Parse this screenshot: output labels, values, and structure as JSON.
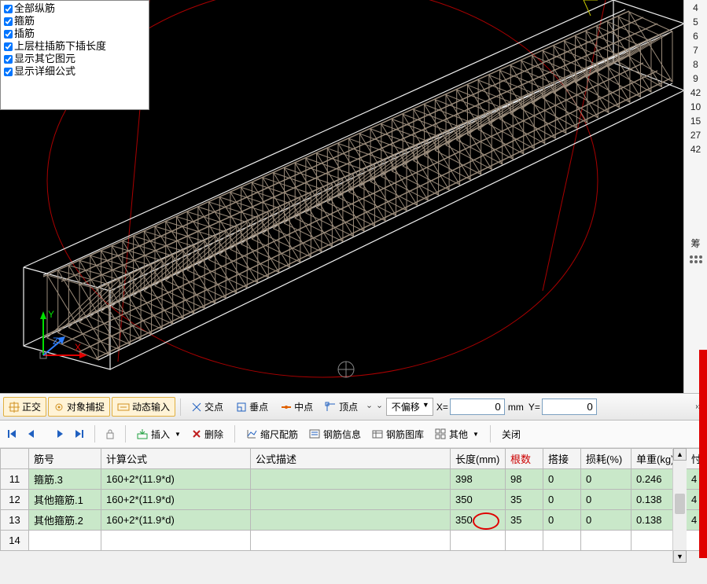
{
  "checkboxes": [
    {
      "label": "全部纵筋",
      "checked": true
    },
    {
      "label": "箍筋",
      "checked": true
    },
    {
      "label": "插筋",
      "checked": true
    },
    {
      "label": "上层柱插筋下插长度",
      "checked": true
    },
    {
      "label": "显示其它图元",
      "checked": true
    },
    {
      "label": "显示详细公式",
      "checked": true
    }
  ],
  "side_numbers": [
    "4",
    "5",
    "6",
    "7",
    "8",
    "9",
    "42",
    "10",
    "15",
    "27",
    "42"
  ],
  "side_char": "筹",
  "statusbar": {
    "ortho": "正交",
    "snap": "对象捕捉",
    "dyn_input": "动态输入",
    "jiaodian": "交点",
    "chuidian": "垂点",
    "zhongdian": "中点",
    "dingdian": "顶点",
    "offset": "不偏移",
    "x_label": "X=",
    "x_value": "0",
    "unit": "mm",
    "y_label": "Y=",
    "y_value": "0"
  },
  "toolbar": {
    "insert": "插入",
    "delete": "删除",
    "scale": "缩尺配筋",
    "info": "钢筋信息",
    "library": "钢筋图库",
    "other": "其他",
    "close": "关闭"
  },
  "table": {
    "headers": {
      "num": "筋号",
      "formula": "计算公式",
      "desc": "公式描述",
      "length": "长度(mm)",
      "count": "根数",
      "overlap": "搭接",
      "loss": "损耗(%)",
      "unit_weight": "单重(kg)",
      "last": "忖"
    },
    "rows": [
      {
        "n": "11",
        "num": "箍筋.3",
        "formula": "160+2*(11.9*d)",
        "desc": "",
        "length": "398",
        "count": "98",
        "overlap": "0",
        "loss": "0",
        "uw": "0.246",
        "last": "4"
      },
      {
        "n": "12",
        "num": "其他箍筋.1",
        "formula": "160+2*(11.9*d)",
        "desc": "",
        "length": "350",
        "count": "35",
        "overlap": "0",
        "loss": "0",
        "uw": "0.138",
        "last": "4"
      },
      {
        "n": "13",
        "num": "其他箍筋.2",
        "formula": "160+2*(11.9*d)",
        "desc": "",
        "length": "350",
        "count": "35",
        "overlap": "0",
        "loss": "0",
        "uw": "0.138",
        "last": "4"
      },
      {
        "n": "14",
        "num": "",
        "formula": "",
        "desc": "",
        "length": "",
        "count": "",
        "overlap": "",
        "loss": "",
        "uw": "",
        "last": ""
      }
    ]
  }
}
